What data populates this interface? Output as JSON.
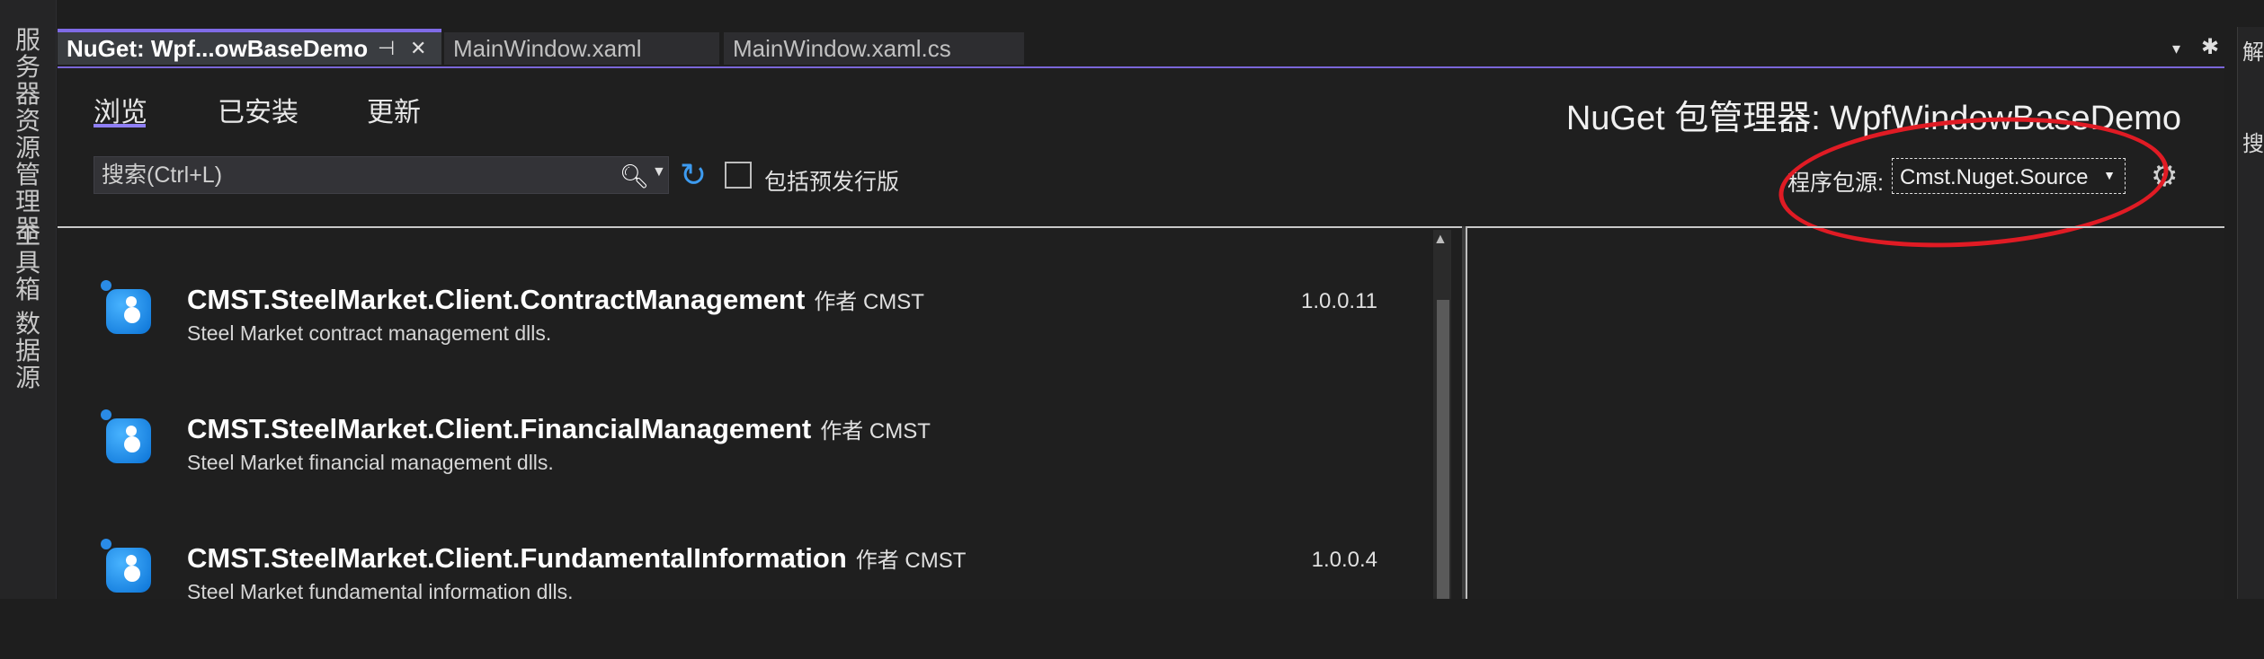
{
  "left_strip": {
    "tabs": [
      "服务器资源管理器",
      "工具箱",
      "数据源"
    ]
  },
  "tabs": [
    {
      "label": "NuGet: Wpf...owBaseDemo",
      "active": true
    },
    {
      "label": "MainWindow.xaml",
      "active": false
    },
    {
      "label": "MainWindow.xaml.cs",
      "active": false
    }
  ],
  "tab_icons": {
    "pin": "⊣",
    "close": "✕",
    "overflow": "▾",
    "settings": "✱"
  },
  "nav": {
    "browse": "浏览",
    "installed": "已安装",
    "updates": "更新"
  },
  "manager_title": "NuGet 包管理器: WpfWindowBaseDemo",
  "search": {
    "placeholder": "搜索(Ctrl+L)",
    "icon": "search-icon"
  },
  "prerelease_label": "包括预发行版",
  "source": {
    "label": "程序包源:",
    "value": "Cmst.Nuget.Source"
  },
  "packages": [
    {
      "name": "CMST.SteelMarket.Client.ContractManagement",
      "author": "作者 CMST",
      "description": "Steel Market contract management dlls.",
      "version": "1.0.0.11"
    },
    {
      "name": "CMST.SteelMarket.Client.FinancialManagement",
      "author": "作者 CMST",
      "description": "Steel Market financial management dlls.",
      "version": ""
    },
    {
      "name": "CMST.SteelMarket.Client.FundamentalInformation",
      "author": "作者 CMST",
      "description": "Steel Market fundamental information dlls.",
      "version": "1.0.0.4"
    }
  ],
  "right_strip": {
    "texts": [
      "解",
      "搜"
    ]
  },
  "colors": {
    "accent": "#7f6be6",
    "annotation": "#e01b24",
    "refresh": "#3d9bf0"
  }
}
